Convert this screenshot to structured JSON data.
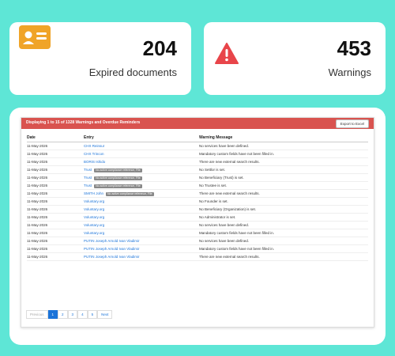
{
  "cards": {
    "docs": {
      "number": "204",
      "label": "Expired documents",
      "icon": "id-card-icon",
      "color": "#f0a428"
    },
    "warnings": {
      "number": "453",
      "label": "Warnings",
      "icon": "warning-triangle-icon",
      "color": "#e8454a"
    }
  },
  "table": {
    "title": "Displaying 1 to 15 of 1328 Warnings and Overdue Reminders",
    "export_label": "Export to Excel",
    "columns": [
      "Date",
      "Entry",
      "Warning Message"
    ],
    "rows": [
      {
        "date": "11-May-2026",
        "entry": "CHX Reinsur",
        "tag": "",
        "message": "No services have been defined."
      },
      {
        "date": "11-May-2026",
        "entry": "CHX Trincon",
        "tag": "",
        "message": "Mandatory custom fields have not been filled in."
      },
      {
        "date": "11-May-2026",
        "entry": "BORIS Ishido",
        "tag": "",
        "message": "There are new external search results."
      },
      {
        "date": "11-May-2026",
        "entry": "Trust",
        "tag": "No active compliance reference, File",
        "message": "No Settlor is set."
      },
      {
        "date": "11-May-2026",
        "entry": "Trust",
        "tag": "No active compliance reference, File",
        "message": "No Beneficiary (Trust) is set."
      },
      {
        "date": "11-May-2026",
        "entry": "Trust",
        "tag": "No active compliance reference, File",
        "message": "No Trustee is set."
      },
      {
        "date": "11-May-2026",
        "entry": "SMITH John",
        "tag": "No active compliance reference, File",
        "message": "There are new external search results."
      },
      {
        "date": "11-May-2026",
        "entry": "Voluntary.org",
        "tag": "",
        "message": "No Founder is set."
      },
      {
        "date": "11-May-2026",
        "entry": "Voluntary.org",
        "tag": "",
        "message": "No Beneficiary (Organization) is set."
      },
      {
        "date": "11-May-2026",
        "entry": "Voluntary.org",
        "tag": "",
        "message": "No Administrator is set."
      },
      {
        "date": "11-May-2026",
        "entry": "Voluntary.org",
        "tag": "",
        "message": "No services have been defined."
      },
      {
        "date": "11-May-2026",
        "entry": "Voluntary.org",
        "tag": "",
        "message": "Mandatory custom fields have not been filled in."
      },
      {
        "date": "11-May-2026",
        "entry": "PUTIN Joseph Arnold Ivan Vladimir",
        "tag": "",
        "message": "No services have been defined."
      },
      {
        "date": "11-May-2026",
        "entry": "PUTIN Joseph Arnold Ivan Vladimir",
        "tag": "",
        "message": "Mandatory custom fields have not been filled in."
      },
      {
        "date": "11-May-2026",
        "entry": "PUTIN Joseph Arnold Ivan Vladimir",
        "tag": "",
        "message": "There are new external search results."
      }
    ]
  },
  "pagination": {
    "prev": "Previous",
    "pages": [
      "1",
      "2",
      "3",
      "4",
      "5"
    ],
    "active": "1",
    "next": "Next"
  }
}
